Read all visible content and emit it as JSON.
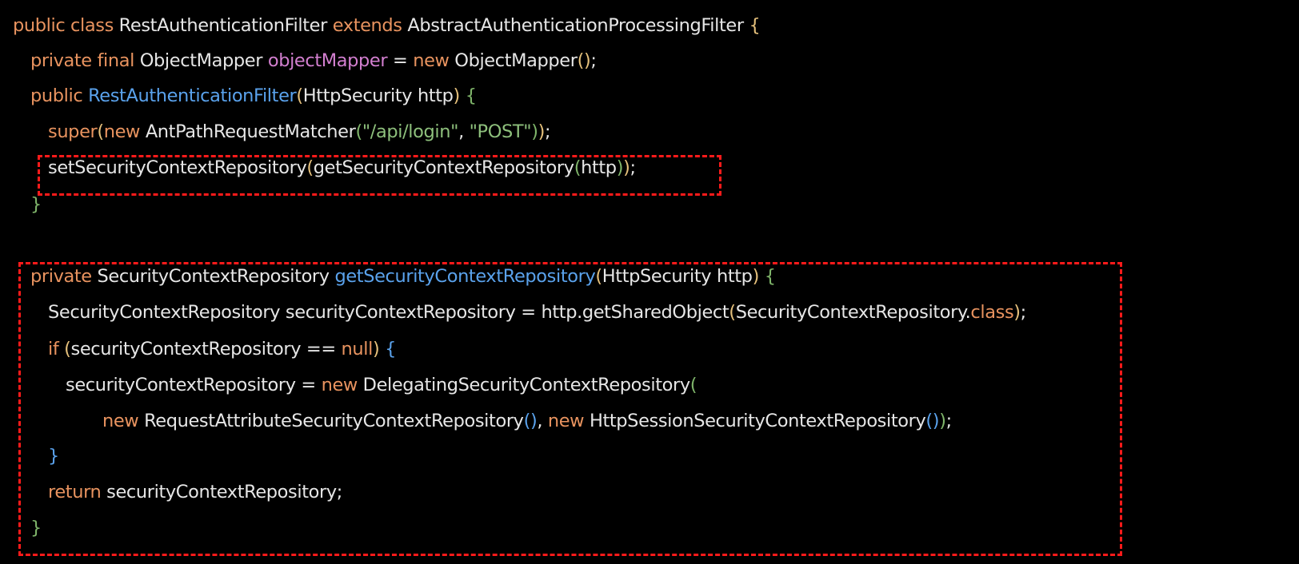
{
  "colors": {
    "background": "#000000",
    "plain": "#e6e6e6",
    "keyword": "#e8935f",
    "field": "#d37fd0",
    "method": "#5aa2ec",
    "string": "#8ec07c",
    "brace_gold": "#e5c07b",
    "brace_green": "#7fb56a",
    "brace_blue": "#5aa2ec",
    "highlight_border": "#ff1a1a"
  },
  "highlights": [
    {
      "name": "highlight-box-set-repository-call"
    },
    {
      "name": "highlight-box-get-repository-method"
    }
  ],
  "code_lines": [
    [
      {
        "t": "public class ",
        "c": "keyword"
      },
      {
        "t": "RestAuthenticationFilter ",
        "c": "plain"
      },
      {
        "t": "extends ",
        "c": "keyword"
      },
      {
        "t": "AbstractAuthenticationProcessingFilter ",
        "c": "plain"
      },
      {
        "t": "{",
        "c": "brace_gold"
      }
    ],
    [
      {
        "t": "private final ",
        "c": "keyword"
      },
      {
        "t": "ObjectMapper ",
        "c": "plain"
      },
      {
        "t": "objectMapper",
        "c": "field"
      },
      {
        "t": " = ",
        "c": "plain"
      },
      {
        "t": "new ",
        "c": "keyword"
      },
      {
        "t": "ObjectMapper",
        "c": "plain"
      },
      {
        "t": "()",
        "c": "brace_gold"
      },
      {
        "t": ";",
        "c": "plain"
      }
    ],
    [
      {
        "t": "public ",
        "c": "keyword"
      },
      {
        "t": "RestAuthenticationFilter",
        "c": "method"
      },
      {
        "t": "(",
        "c": "brace_gold"
      },
      {
        "t": "HttpSecurity http",
        "c": "plain"
      },
      {
        "t": ") ",
        "c": "brace_gold"
      },
      {
        "t": "{",
        "c": "brace_green"
      }
    ],
    [
      {
        "t": "super",
        "c": "keyword"
      },
      {
        "t": "(",
        "c": "brace_gold"
      },
      {
        "t": "new ",
        "c": "keyword"
      },
      {
        "t": "AntPathRequestMatcher",
        "c": "plain"
      },
      {
        "t": "(",
        "c": "brace_green"
      },
      {
        "t": "\"/api/login\"",
        "c": "string"
      },
      {
        "t": ", ",
        "c": "plain"
      },
      {
        "t": "\"POST\"",
        "c": "string"
      },
      {
        "t": ")",
        "c": "brace_green"
      },
      {
        "t": ")",
        "c": "brace_gold"
      },
      {
        "t": ";",
        "c": "plain"
      }
    ],
    [
      {
        "t": "setSecurityContextRepository",
        "c": "plain"
      },
      {
        "t": "(",
        "c": "brace_gold"
      },
      {
        "t": "getSecurityContextRepository",
        "c": "plain"
      },
      {
        "t": "(",
        "c": "brace_green"
      },
      {
        "t": "http",
        "c": "plain"
      },
      {
        "t": ")",
        "c": "brace_green"
      },
      {
        "t": ")",
        "c": "brace_gold"
      },
      {
        "t": ";",
        "c": "plain"
      }
    ],
    [
      {
        "t": "}",
        "c": "brace_green"
      }
    ],
    [],
    [
      {
        "t": "private ",
        "c": "keyword"
      },
      {
        "t": "SecurityContextRepository ",
        "c": "plain"
      },
      {
        "t": "getSecurityContextRepository",
        "c": "method"
      },
      {
        "t": "(",
        "c": "brace_gold"
      },
      {
        "t": "HttpSecurity http",
        "c": "plain"
      },
      {
        "t": ") ",
        "c": "brace_gold"
      },
      {
        "t": "{",
        "c": "brace_green"
      }
    ],
    [
      {
        "t": "SecurityContextRepository securityContextRepository = http.getSharedObject",
        "c": "plain"
      },
      {
        "t": "(",
        "c": "brace_gold"
      },
      {
        "t": "SecurityContextRepository.",
        "c": "plain"
      },
      {
        "t": "class",
        "c": "keyword"
      },
      {
        "t": ")",
        "c": "brace_gold"
      },
      {
        "t": ";",
        "c": "plain"
      }
    ],
    [
      {
        "t": "if ",
        "c": "keyword"
      },
      {
        "t": "(",
        "c": "brace_gold"
      },
      {
        "t": "securityContextRepository == ",
        "c": "plain"
      },
      {
        "t": "null",
        "c": "keyword"
      },
      {
        "t": ") ",
        "c": "brace_gold"
      },
      {
        "t": "{",
        "c": "brace_blue"
      }
    ],
    [
      {
        "t": "securityContextRepository = ",
        "c": "plain"
      },
      {
        "t": "new ",
        "c": "keyword"
      },
      {
        "t": "DelegatingSecurityContextRepository",
        "c": "plain"
      },
      {
        "t": "(",
        "c": "brace_green"
      }
    ],
    [
      {
        "t": "new ",
        "c": "keyword"
      },
      {
        "t": "RequestAttributeSecurityContextRepository",
        "c": "plain"
      },
      {
        "t": "()",
        "c": "brace_blue"
      },
      {
        "t": ", ",
        "c": "plain"
      },
      {
        "t": "new ",
        "c": "keyword"
      },
      {
        "t": "HttpSessionSecurityContextRepository",
        "c": "plain"
      },
      {
        "t": "()",
        "c": "brace_blue"
      },
      {
        "t": ")",
        "c": "brace_green"
      },
      {
        "t": ";",
        "c": "plain"
      }
    ],
    [
      {
        "t": "}",
        "c": "brace_blue"
      }
    ],
    [
      {
        "t": "return ",
        "c": "keyword"
      },
      {
        "t": "securityContextRepository;",
        "c": "plain"
      }
    ],
    [
      {
        "t": "}",
        "c": "brace_green"
      }
    ]
  ]
}
